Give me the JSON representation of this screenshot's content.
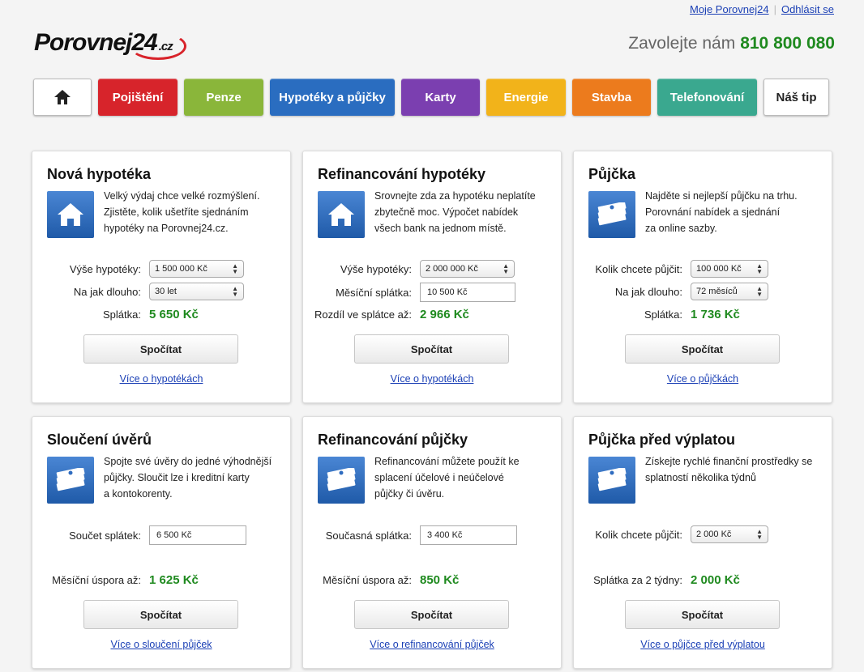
{
  "header": {
    "account_link": "Moje Porovnej24",
    "logout_link": "Odhlásit se",
    "logo_text": "Porovnej24",
    "logo_tld": ".cz",
    "phone_label": "Zavolejte nám",
    "phone_number": "810 800 080"
  },
  "nav": {
    "home_icon": "home-icon",
    "tabs": [
      {
        "label": "Pojištění",
        "color": "#d7242b"
      },
      {
        "label": "Penze",
        "color": "#8ab63a"
      },
      {
        "label": "Hypotéky a půjčky",
        "color": "#2a6dc0"
      },
      {
        "label": "Karty",
        "color": "#7b3fb0"
      },
      {
        "label": "Energie",
        "color": "#f2b31a"
      },
      {
        "label": "Stavba",
        "color": "#ec7b1d"
      },
      {
        "label": "Telefonování",
        "color": "#3aa88f"
      }
    ],
    "tip_label": "Náš tip"
  },
  "cards": [
    {
      "title": "Nová hypotéka",
      "icon": "house-icon",
      "desc": [
        "Velký výdaj chce velké rozmýšlení.",
        "Zjistěte, kolik ušetříte sjednáním",
        "hypotéky na Porovnej24.cz."
      ],
      "field1_label": "Výše hypotéky:",
      "field1_value": "1 500 000 Kč",
      "field2_label": "Na jak dlouho:",
      "field2_value": "30 let",
      "result_label": "Splátka:",
      "result_value": "5 650 Kč",
      "button": "Spočítat",
      "link": "Více o hypotékách"
    },
    {
      "title": "Refinancování hypotéky",
      "icon": "house-icon",
      "desc": [
        "Srovnejte zda za hypotéku neplatíte",
        "zbytečně moc. Výpočet nabídek",
        "všech bank na jednom místě."
      ],
      "field1_label": "Výše hypotéky:",
      "field1_value": "2 000 000 Kč",
      "field2_label": "Měsíční splátka:",
      "field2_value": "10 500 Kč",
      "result_label": "Rozdíl ve splátce až:",
      "result_value": "2 966 Kč",
      "button": "Spočítat",
      "link": "Více o hypotékách"
    },
    {
      "title": "Půjčka",
      "icon": "money-icon",
      "desc": [
        "Najděte si nejlepší půjčku na trhu.",
        "Porovnání nabídek a sjednání",
        "za online sazby."
      ],
      "field1_label": "Kolik chcete půjčit:",
      "field1_value": "100 000 Kč",
      "field2_label": "Na jak dlouho:",
      "field2_value": "72 měsíců",
      "result_label": "Splátka:",
      "result_value": "1 736 Kč",
      "button": "Spočítat",
      "link": "Více o půjčkách"
    },
    {
      "title": "Sloučení úvěrů",
      "icon": "money-icon",
      "desc": [
        "Spojte své úvěry do jedné výhodnější",
        "půjčky. Sloučit lze i kreditní karty",
        "a kontokorenty."
      ],
      "field1_label": "Součet splátek:",
      "field1_value": "6 500 Kč",
      "result_label": "Měsíční úspora až:",
      "result_value": "1 625 Kč",
      "button": "Spočítat",
      "link": "Více o sloučení půjček"
    },
    {
      "title": "Refinancování půjčky",
      "icon": "money-icon",
      "desc": [
        "Refinancování můžete použít ke",
        "splacení účelové i neúčelové",
        "půjčky či úvěru."
      ],
      "field1_label": "Současná splátka:",
      "field1_value": "3 400 Kč",
      "result_label": "Měsíční úspora až:",
      "result_value": "850 Kč",
      "button": "Spočítat",
      "link": "Více o refinancování půjček"
    },
    {
      "title": "Půjčka před výplatou",
      "icon": "money-icon",
      "desc": [
        "Získejte rychlé finanční prostředky se",
        "splatností několika týdnů"
      ],
      "field1_label": "Kolik chcete půjčit:",
      "field1_value": "2 000 Kč",
      "result_label": "Splátka za 2 týdny:",
      "result_value": "2 000 Kč",
      "button": "Spočítat",
      "link": "Více o půjčce před výplatou"
    }
  ]
}
